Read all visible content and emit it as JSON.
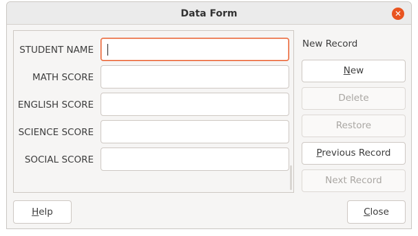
{
  "window": {
    "title": "Data Form"
  },
  "fields": [
    {
      "label": "STUDENT NAME",
      "value": "",
      "focused": true
    },
    {
      "label": "MATH SCORE",
      "value": ""
    },
    {
      "label": "ENGLISH SCORE",
      "value": ""
    },
    {
      "label": "SCIENCE SCORE",
      "value": ""
    },
    {
      "label": "SOCIAL SCORE",
      "value": ""
    }
  ],
  "side": {
    "status": "New Record",
    "buttons": {
      "new": {
        "mnemonic": "N",
        "rest": "ew",
        "enabled": true
      },
      "delete": {
        "label": "Delete",
        "enabled": false
      },
      "restore": {
        "label": "Restore",
        "enabled": false
      },
      "previous": {
        "mnemonic": "P",
        "rest": "revious Record",
        "enabled": true
      },
      "next": {
        "label": "Next Record",
        "enabled": false
      }
    }
  },
  "footer": {
    "help": {
      "mnemonic": "H",
      "rest": "elp"
    },
    "close": {
      "mnemonic": "C",
      "rest": "lose"
    }
  },
  "colors": {
    "accent": "#e95420",
    "window_bg": "#f6f5f4"
  }
}
